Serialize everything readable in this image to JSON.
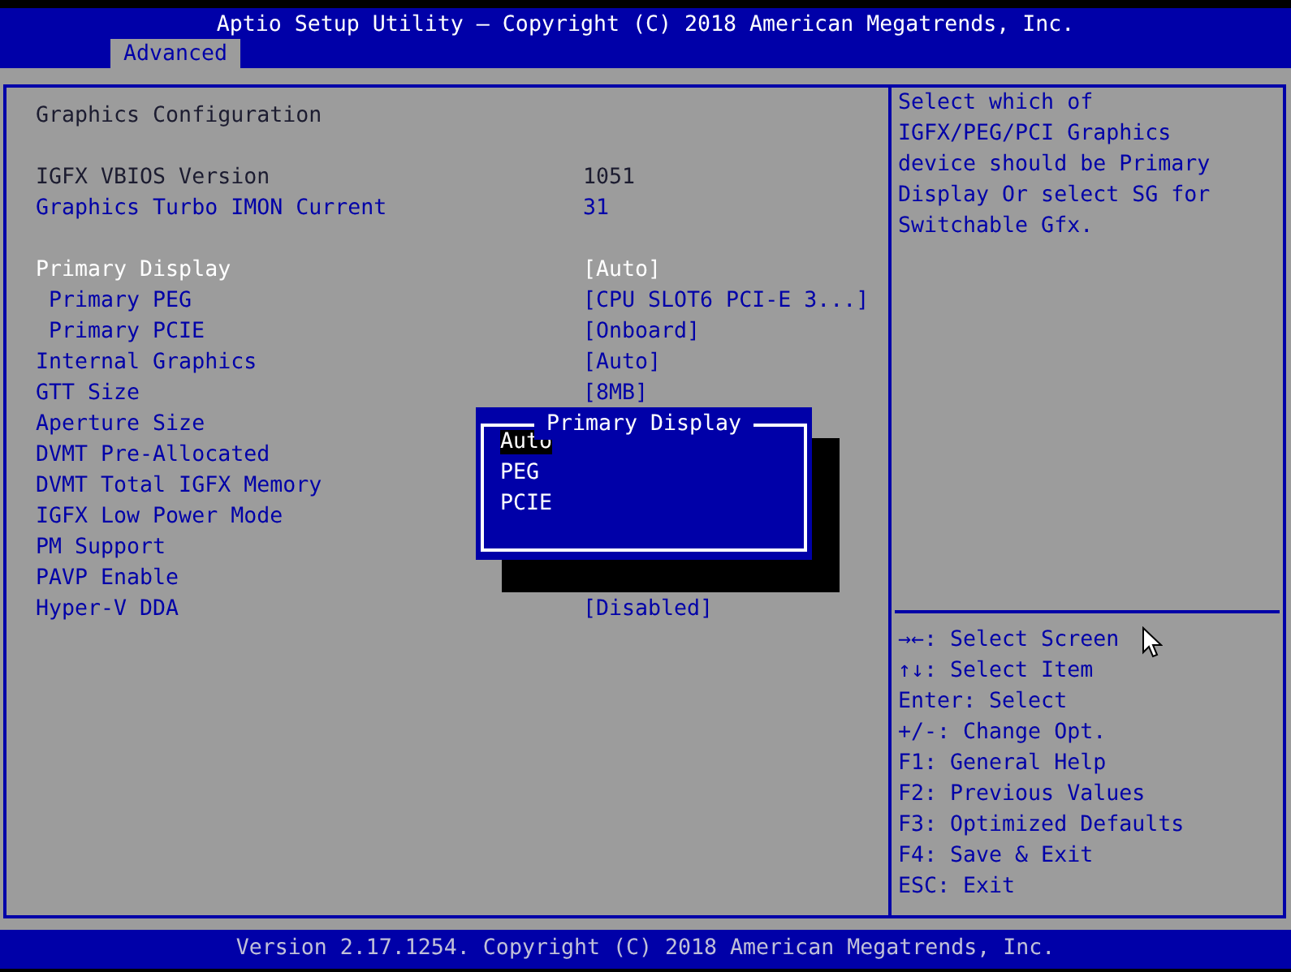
{
  "window": {
    "title": "Aptio Setup Utility – Copyright (C) 2018 American Megatrends, Inc."
  },
  "tabs": [
    {
      "label": "Advanced",
      "selected": true
    }
  ],
  "section_title": "Graphics Configuration",
  "groups": [
    [
      {
        "label": "IGFX VBIOS Version",
        "value": "1051",
        "kind": "static",
        "selected": false
      },
      {
        "label": "Graphics Turbo IMON Current",
        "value": "31",
        "kind": "option",
        "selected": false
      }
    ],
    [
      {
        "label": "Primary Display",
        "value": "[Auto]",
        "kind": "option",
        "selected": true,
        "children": [
          {
            "label": "Primary PEG",
            "value": "[CPU SLOT6 PCI-E 3...]",
            "kind": "option",
            "selected": false
          },
          {
            "label": "Primary PCIE",
            "value": "[Onboard]",
            "kind": "option",
            "selected": false
          }
        ]
      },
      {
        "label": "Internal Graphics",
        "value": "[Auto]",
        "kind": "option",
        "selected": false
      },
      {
        "label": "GTT Size",
        "value": "[8MB]",
        "kind": "option",
        "selected": false
      },
      {
        "label": "Aperture Size",
        "kind": "option",
        "selected": false
      },
      {
        "label": "DVMT Pre-Allocated",
        "kind": "option",
        "selected": false
      },
      {
        "label": "DVMT Total IGFX Memory",
        "kind": "option",
        "selected": false
      },
      {
        "label": "IGFX Low Power Mode",
        "kind": "option",
        "selected": false
      },
      {
        "label": "PM Support",
        "kind": "option",
        "selected": false
      },
      {
        "label": "PAVP Enable",
        "kind": "option",
        "selected": false
      },
      {
        "label": "Hyper-V DDA",
        "value": "[Disabled]",
        "kind": "option",
        "selected": false
      }
    ]
  ],
  "popup": {
    "title": "Primary Display",
    "options": [
      {
        "label": "Auto",
        "selected": true
      },
      {
        "label": "PEG",
        "selected": false
      },
      {
        "label": "PCIE",
        "selected": false
      }
    ]
  },
  "help_text": "Select which of IGFX/PEG/PCI Graphics device should be Primary Display Or select SG for Switchable Gfx.",
  "key_hints": [
    "→←: Select Screen",
    "↑↓: Select Item",
    "Enter: Select",
    "+/-: Change Opt.",
    "F1: General Help",
    "F2: Previous Values",
    "F3: Optimized Defaults",
    "F4: Save & Exit",
    "ESC: Exit"
  ],
  "status_bar": "Version 2.17.1254. Copyright (C) 2018 American Megatrends, Inc."
}
